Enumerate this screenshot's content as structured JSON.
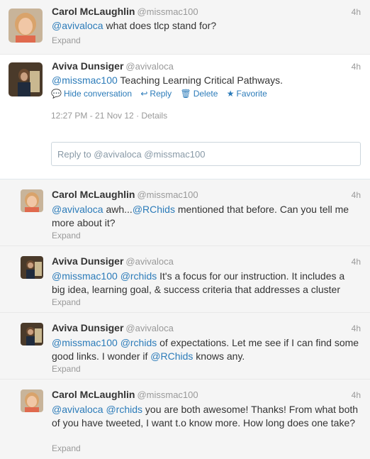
{
  "tweets": [
    {
      "name": "Carol McLaughlin",
      "handle": "@missmac100",
      "time": "4h",
      "text": [
        {
          "t": "@avivaloca",
          "m": true
        },
        {
          "t": " what does tlcp stand for?",
          "m": false
        }
      ],
      "expand": "Expand"
    },
    {
      "name": "Aviva Dunsiger",
      "handle": "@avivaloca",
      "time": "4h",
      "text": [
        {
          "t": "@missmac100",
          "m": true
        },
        {
          "t": " Teaching Learning Critical Pathways.",
          "m": false
        }
      ],
      "actions": {
        "hide": "Hide conversation",
        "reply": "Reply",
        "delete": "Delete",
        "favorite": "Favorite"
      },
      "meta": "12:27 PM - 21 Nov 12 · Details"
    },
    {
      "name": "Carol McLaughlin",
      "handle": "@missmac100",
      "time": "4h",
      "text": [
        {
          "t": "@avivaloca",
          "m": true
        },
        {
          "t": " awh...",
          "m": false
        },
        {
          "t": "@RChids",
          "m": true
        },
        {
          "t": " mentioned that before. Can you tell me more about it?",
          "m": false
        }
      ],
      "expand": "Expand"
    },
    {
      "name": "Aviva Dunsiger",
      "handle": "@avivaloca",
      "time": "4h",
      "text": [
        {
          "t": "@missmac100",
          "m": true
        },
        {
          "t": " ",
          "m": false
        },
        {
          "t": "@rchids",
          "m": true
        },
        {
          "t": " It's a focus for our instruction. It includes a big idea, learning goal, & success criteria that addresses a cluster",
          "m": false
        }
      ],
      "expand": "Expand"
    },
    {
      "name": "Aviva Dunsiger",
      "handle": "@avivaloca",
      "time": "4h",
      "text": [
        {
          "t": "@missmac100",
          "m": true
        },
        {
          "t": " ",
          "m": false
        },
        {
          "t": "@rchids",
          "m": true
        },
        {
          "t": " of expectations. Let me see if I can find some good links. I wonder if ",
          "m": false
        },
        {
          "t": "@RChids",
          "m": true
        },
        {
          "t": " knows any.",
          "m": false
        }
      ],
      "expand": "Expand"
    },
    {
      "name": "Carol McLaughlin",
      "handle": "@missmac100",
      "time": "4h",
      "text": [
        {
          "t": "@avivaloca",
          "m": true
        },
        {
          "t": " ",
          "m": false
        },
        {
          "t": "@rchids",
          "m": true
        },
        {
          "t": " you are both awesome! Thanks! From what both of you have tweeted, I want t.o know more. How long does one take?",
          "m": false
        }
      ],
      "expand": "Expand"
    }
  ],
  "reply_box": {
    "placeholder": "Reply to @avivaloca @missmac100"
  },
  "icons": {
    "hide": "speech-bubble-icon",
    "reply": "reply-arrow-icon",
    "delete": "trash-icon",
    "favorite": "star-icon"
  },
  "colors": {
    "link": "#2b7bb9",
    "muted": "#999999",
    "background": "#f5f5f5"
  }
}
